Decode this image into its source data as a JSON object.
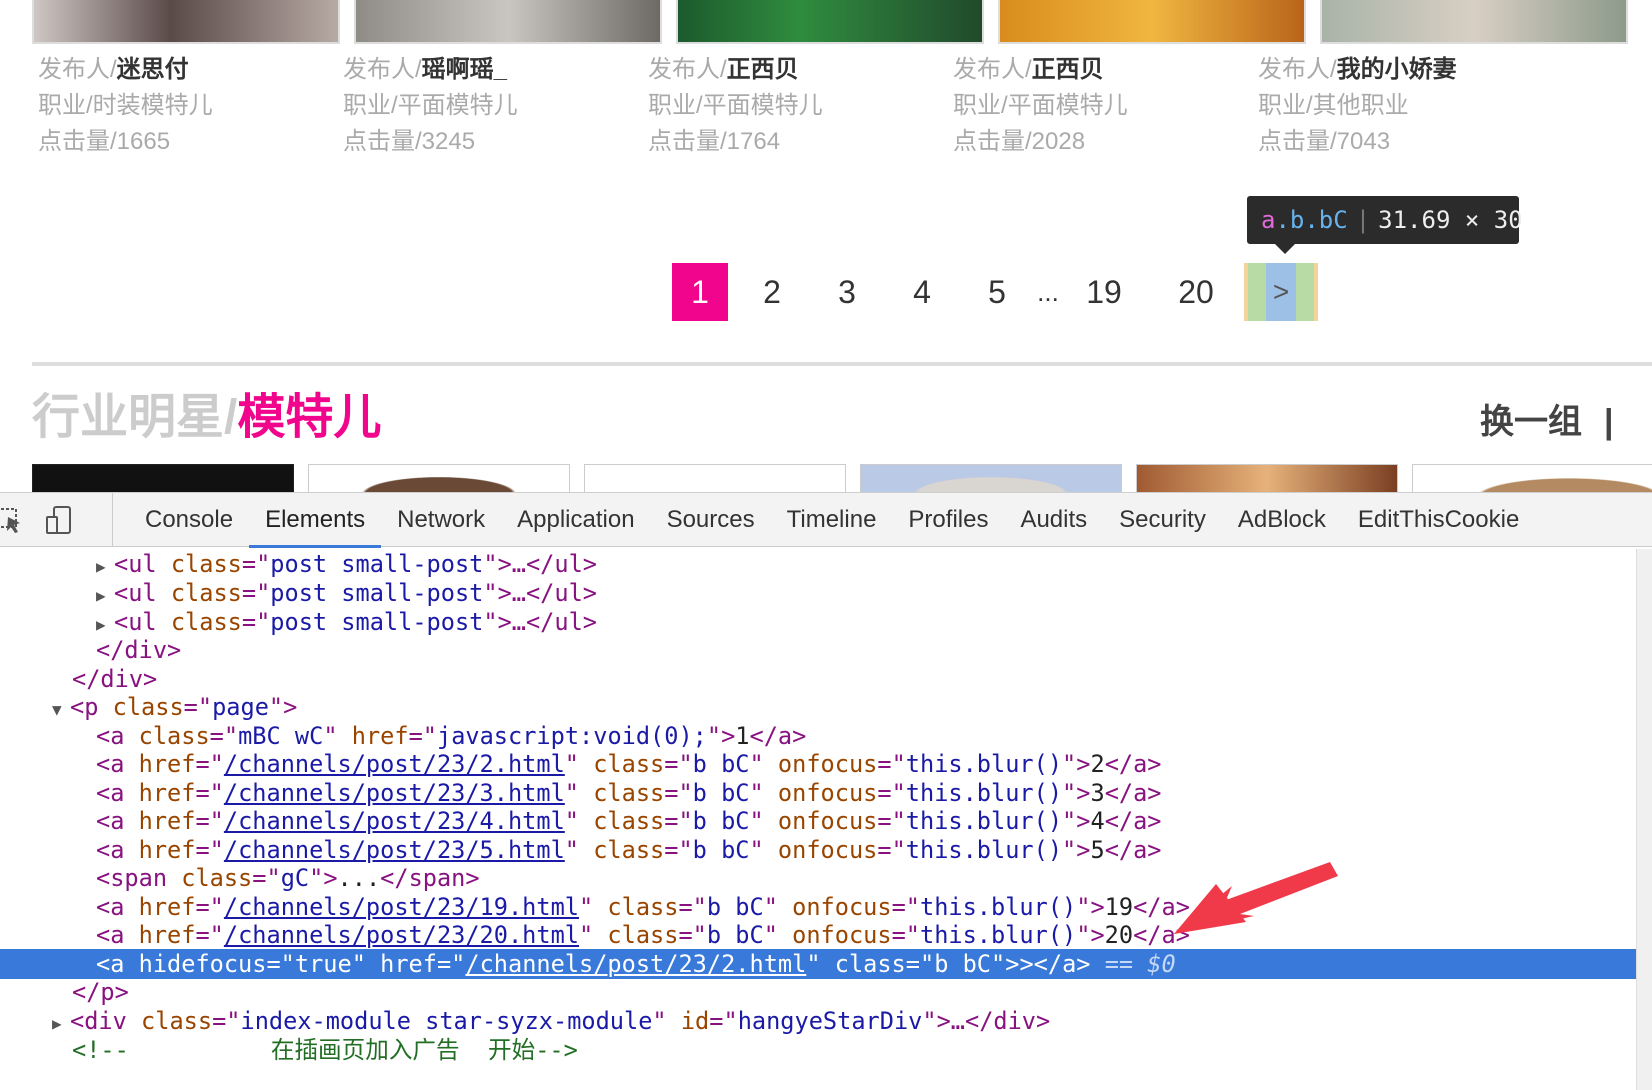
{
  "posts": [
    {
      "publisher_label": "发布人/",
      "publisher": "迷思付",
      "job_label": "职业/",
      "job": "时装模特儿",
      "clicks_label": "点击量/",
      "clicks": "1665"
    },
    {
      "publisher_label": "发布人/",
      "publisher": "瑶啊瑶_",
      "job_label": "职业/",
      "job": "平面模特儿",
      "clicks_label": "点击量/",
      "clicks": "3245"
    },
    {
      "publisher_label": "发布人/",
      "publisher": "正西贝",
      "job_label": "职业/",
      "job": "平面模特儿",
      "clicks_label": "点击量/",
      "clicks": "1764"
    },
    {
      "publisher_label": "发布人/",
      "publisher": "正西贝",
      "job_label": "职业/",
      "job": "平面模特儿",
      "clicks_label": "点击量/",
      "clicks": "2028"
    },
    {
      "publisher_label": "发布人/",
      "publisher": "我的小娇妻",
      "job_label": "职业/",
      "job": "其他职业",
      "clicks_label": "点击量/",
      "clicks": "7043"
    }
  ],
  "tooltip": {
    "tag": "a",
    "classes": ".b.bC",
    "size": "31.69 × 30"
  },
  "pager": {
    "pages": [
      "1",
      "2",
      "3",
      "4",
      "5",
      "...",
      "19",
      "20"
    ],
    "current": "1",
    "next": ">"
  },
  "section": {
    "title_muted": "行业明星/",
    "title_highlight": "模特儿",
    "swap": "换一组",
    "divider": "|"
  },
  "devtools": {
    "tabs": [
      "Console",
      "Elements",
      "Network",
      "Application",
      "Sources",
      "Timeline",
      "Profiles",
      "Audits",
      "Security",
      "AdBlock",
      "EditThisCookie"
    ],
    "active_tab": "Elements",
    "lines": [
      {
        "tri": "▶",
        "t1": "<ul ",
        "an1": "class",
        "eq": "=\"",
        "av1": "post small-post",
        "t2": "\">…</ul>"
      },
      {
        "tri": "▶",
        "t1": "<ul ",
        "an1": "class",
        "eq": "=\"",
        "av1": "post small-post",
        "t2": "\">…</ul>"
      },
      {
        "tri": "▶",
        "t1": "<ul ",
        "an1": "class",
        "eq": "=\"",
        "av1": "post small-post",
        "t2": "\">…</ul>"
      },
      {
        "t1": "</div>"
      },
      {
        "t1": "</div>"
      },
      {
        "tri": "▼",
        "t1": "<p ",
        "an1": "class",
        "eq": "=\"",
        "av1": "page",
        "t2": "\">"
      },
      {
        "t1": "<a ",
        "an1": "class",
        "av1": "mBC wC",
        "an2": "href",
        "av2": "javascript:void(0);",
        "tx": "1",
        "t3": "</a>"
      },
      {
        "href": "/channels/post/23/2.html",
        "cls": "b bC",
        "fn": "this.blur()",
        "tx": "2"
      },
      {
        "href": "/channels/post/23/3.html",
        "cls": "b bC",
        "fn": "this.blur()",
        "tx": "3"
      },
      {
        "href": "/channels/post/23/4.html",
        "cls": "b bC",
        "fn": "this.blur()",
        "tx": "4"
      },
      {
        "href": "/channels/post/23/5.html",
        "cls": "b bC",
        "fn": "this.blur()",
        "tx": "5"
      },
      {
        "t1": "<span ",
        "an1": "class",
        "av1": "gC",
        "tx": "...",
        "t3": "</span>"
      },
      {
        "href": "/channels/post/23/19.html",
        "cls": "b bC",
        "fn": "this.blur()",
        "tx": "19"
      },
      {
        "href": "/channels/post/23/20.html",
        "cls": "b bC",
        "fn": "this.blur()",
        "tx": "20"
      },
      {
        "sel_hidefocus": "true",
        "href": "/channels/post/23/2.html",
        "cls": "b bC",
        "tx": ">",
        "eq0": "== $0"
      },
      {
        "t1": "</p>"
      },
      {
        "tri": "▶",
        "t1": "<div ",
        "an1": "class",
        "av1": "index-module star-syzx-module",
        "an2": "id",
        "av2": "hangyeStarDiv",
        "t3": ">…</div>"
      },
      {
        "comment": "<!--          在插画页加入广告  开始-->"
      }
    ]
  },
  "colors": {
    "accent": "#f0058c",
    "selection": "#3879d9",
    "arrow": "#f03a4a"
  }
}
